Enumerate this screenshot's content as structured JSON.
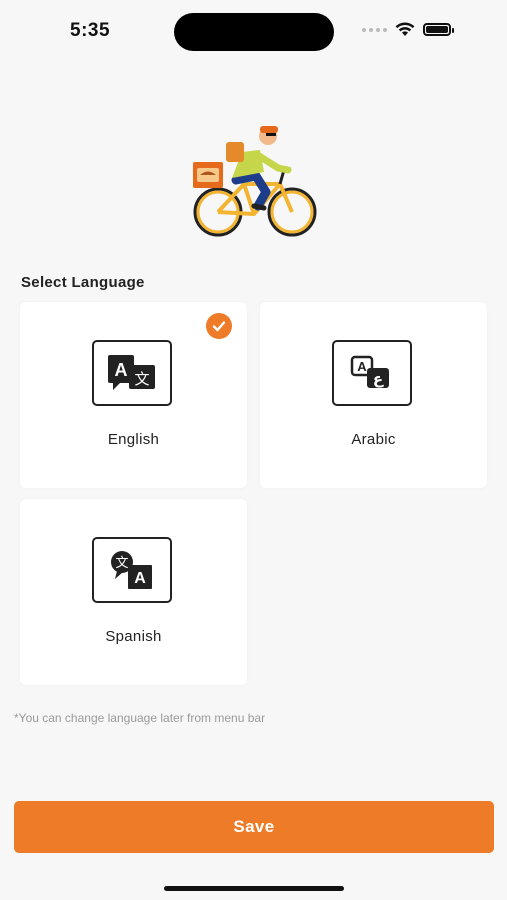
{
  "status_bar": {
    "time": "5:35",
    "icons": [
      "signal-icon",
      "wifi-icon",
      "battery-icon"
    ]
  },
  "hero": {
    "image": "delivery-rider-illustration"
  },
  "section_title": "Select Language",
  "languages": [
    {
      "label": "English",
      "icon": "translate-a-icon",
      "selected": true
    },
    {
      "label": "Arabic",
      "icon": "translate-arabic-icon",
      "selected": false
    },
    {
      "label": "Spanish",
      "icon": "translate-zh-a-icon",
      "selected": false
    }
  ],
  "note": "*You can change language later from menu bar",
  "save_label": "Save",
  "colors": {
    "accent": "#ee7b28",
    "background": "#f7f7f7",
    "card": "#ffffff"
  }
}
